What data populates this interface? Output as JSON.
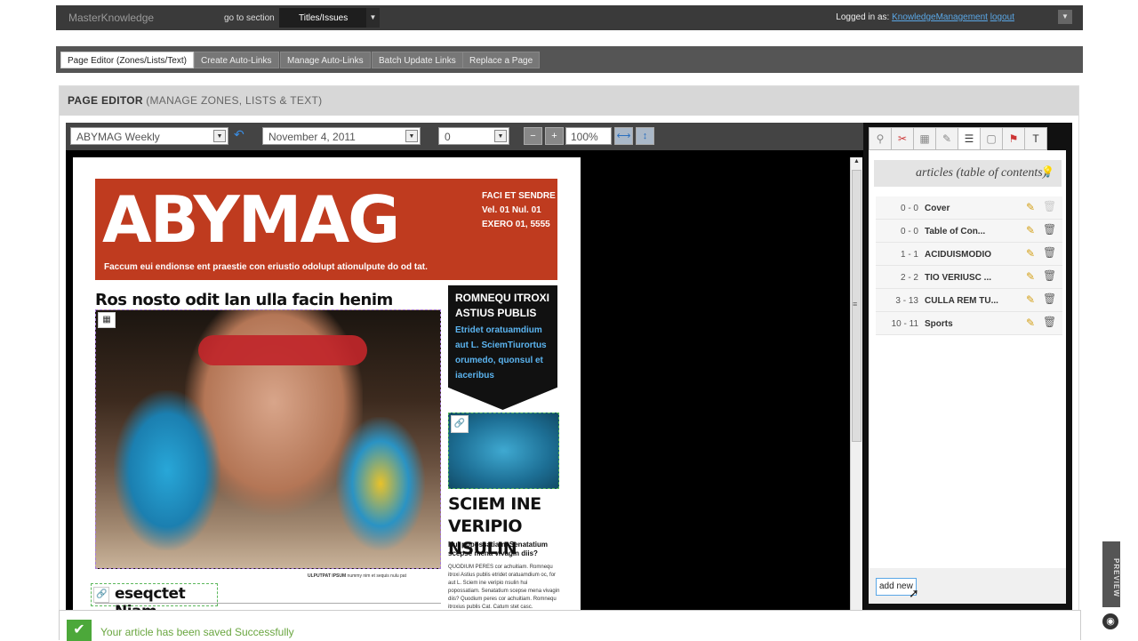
{
  "topbar": {
    "brand": "MasterKnowledge",
    "goto_label": "go to section",
    "section_value": "Titles/Issues",
    "login_prefix": "Logged in as:",
    "login_user": "KnowledgeManagement",
    "logout": "logout"
  },
  "toolbar": {
    "tabs": [
      {
        "label": "Page Editor (Zones/Lists/Text)",
        "active": true
      },
      {
        "label": "Create Auto-Links"
      },
      {
        "label": "Manage Auto-Links"
      },
      {
        "label": "Batch Update Links"
      },
      {
        "label": "Replace a Page"
      }
    ]
  },
  "panel": {
    "title": "PAGE EDITOR",
    "subtitle": "(MANAGE ZONES, LISTS & TEXT)"
  },
  "editor": {
    "publication": "ABYMAG Weekly",
    "date": "November 4, 2011",
    "page": "0",
    "zoom": "100%"
  },
  "magazine": {
    "title": "ABYMAG",
    "issue_line1": "FACI  ET SENDRE",
    "issue_line2": "Vel. 01  Nul. 01",
    "issue_line3": "EXERO 01, 5555",
    "tagline": "Faccum eui endionse ent praestie con eriustio odolupt ationulpute do od tat.",
    "headline": "Ros nosto odit lan ulla facin henim",
    "credit_bold": "ULPUTPAT IPSUM",
    "credit_rest": "nummy nim et sequis nulu pat",
    "sub_headline": "eseqctet Niam",
    "sidebox_head": "ROMNEQU ITROXI ASTIUS PUBLIS",
    "sidebox_body": "Etridet oratuamdium aut L. SciemTiurortus orumedo, quonsul  et iaceribus",
    "diver_headline": "SCIEM INE VERIPIO NSULIN",
    "diver_sub": "Hui popossatiam. Senatatium scepse mena vivagin diis?",
    "diver_body": "QUODIUM PERES cor achuitiam. Romnequ itroxi Astius publis etridet oratuamdium oc, for aut L. Sciem ine veripio nsulin hui popossatiam. Senatatium scepse mena vivagin diis? Quodium peres cor achuitiam. Romnequ itroxius publis Cat. Catum stet casc."
  },
  "rightpanel": {
    "title": "articles (table of contents)",
    "articles": [
      {
        "num": "0 - 0",
        "name": "Cover",
        "delete_disabled": true
      },
      {
        "num": "0 - 0",
        "name": "Table of Con..."
      },
      {
        "num": "1 - 1",
        "name": "ACIDUISMODIO"
      },
      {
        "num": "2 - 2",
        "name": "TIO VERIUSC ..."
      },
      {
        "num": "3 - 13",
        "name": "CULLA REM TU..."
      },
      {
        "num": "10 - 11",
        "name": "Sports"
      }
    ],
    "add_new": "add new"
  },
  "preview_label": "PREVIEW",
  "notice": {
    "message": "Your article has been saved Successfully"
  }
}
